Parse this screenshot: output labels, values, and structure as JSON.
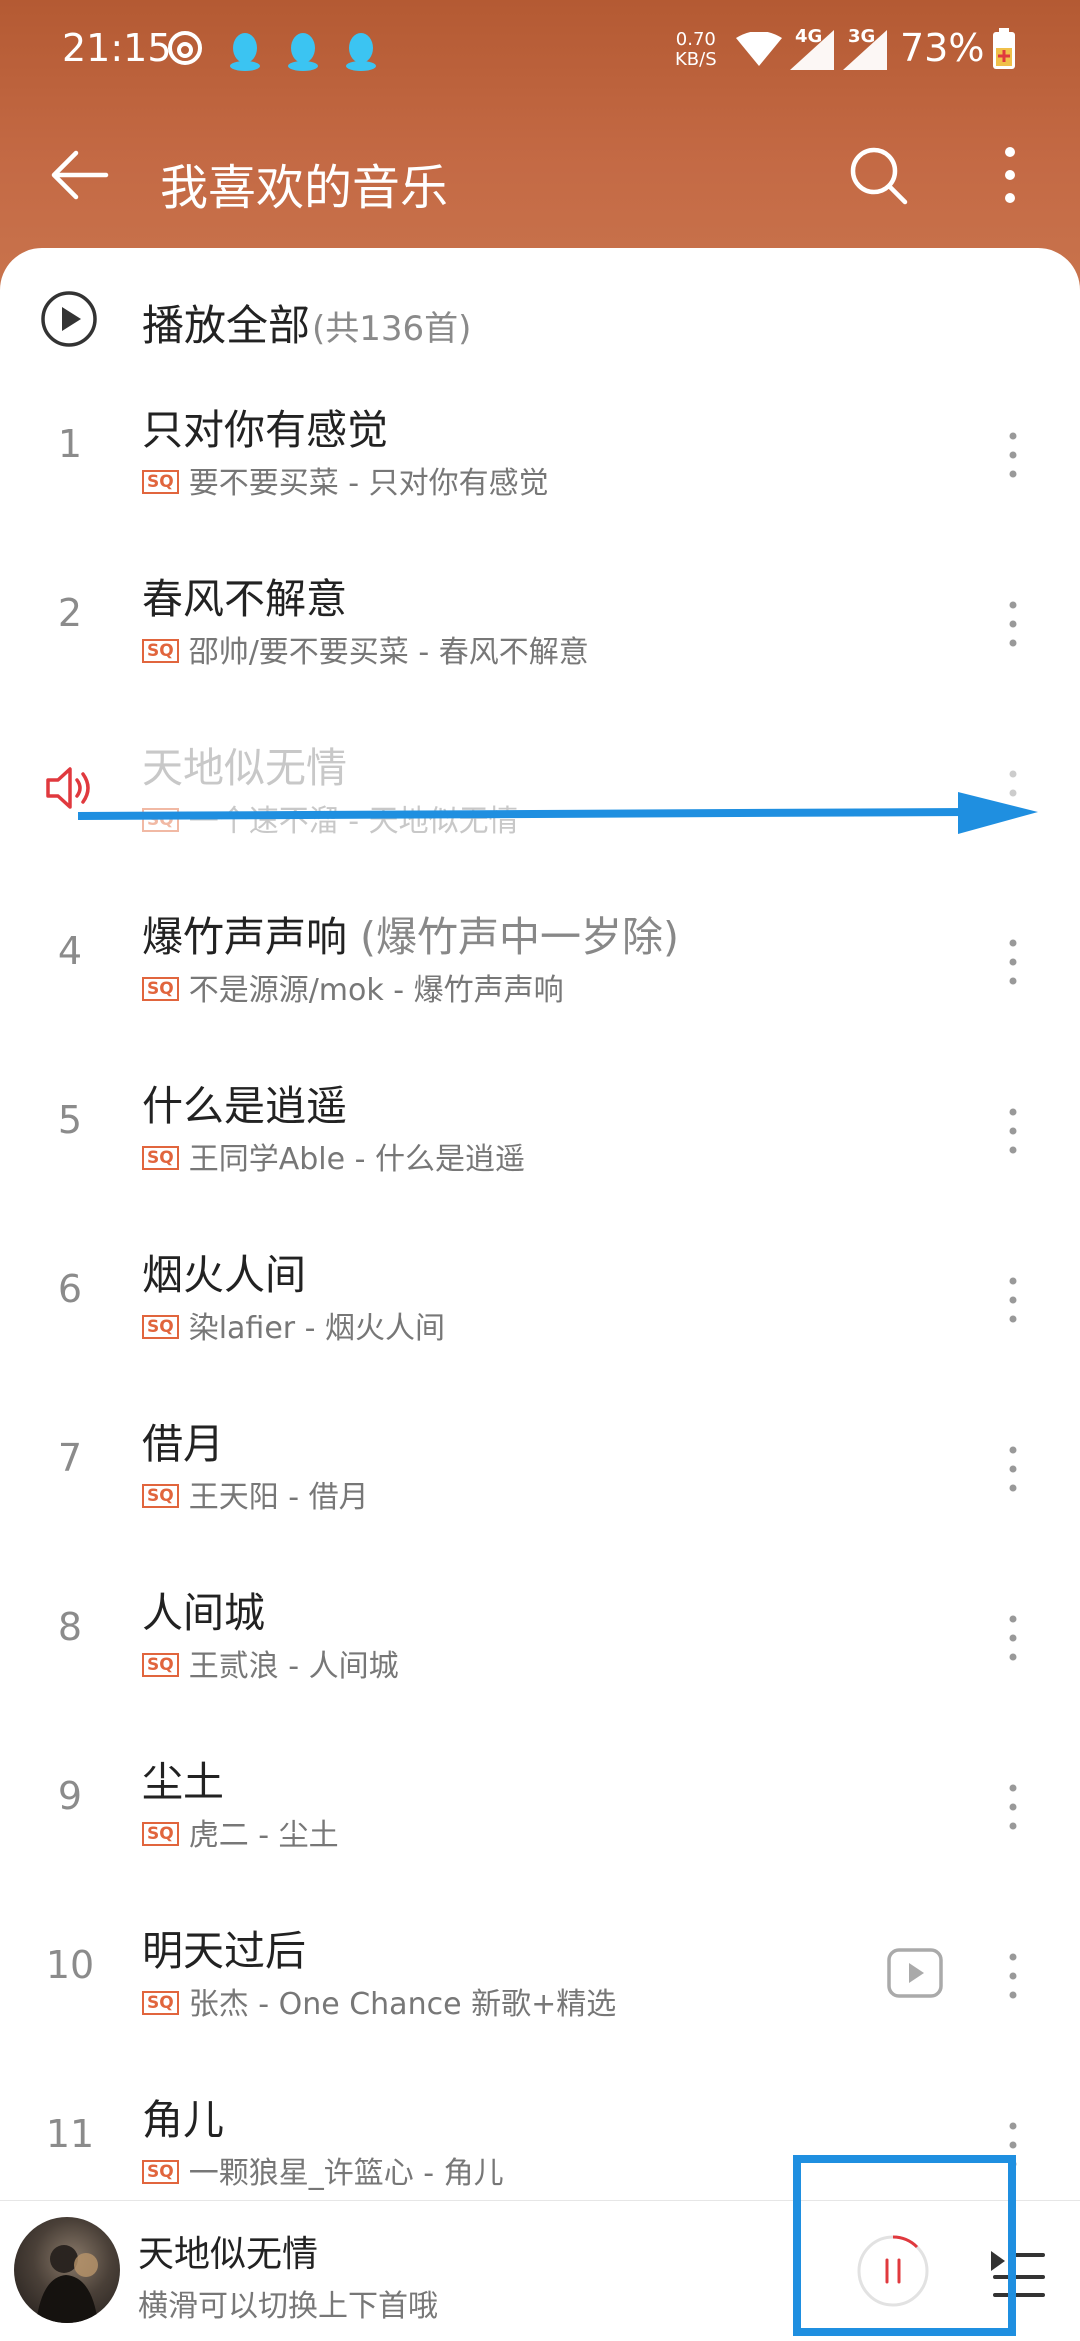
{
  "status_bar": {
    "time": "21:15",
    "net_speed_value": "0.70",
    "net_speed_unit": "KB/S",
    "signal1_label": "4G",
    "signal2_label": "3G",
    "battery": "73%"
  },
  "topbar": {
    "title": "我喜欢的音乐"
  },
  "play_all": {
    "label": "播放全部",
    "count": "(共136首)"
  },
  "songs": [
    {
      "index": "1",
      "title": "只对你有感觉",
      "title_alt": "",
      "subtitle": "要不要买菜 - 只对你有感觉"
    },
    {
      "index": "2",
      "title": "春风不解意",
      "title_alt": "",
      "subtitle": "邵帅/要不要买菜 - 春风不解意"
    },
    {
      "index": "",
      "title": "天地似无情",
      "title_alt": "",
      "subtitle": "一个速不溜 - 天地似无情"
    },
    {
      "index": "4",
      "title": "爆竹声声响",
      "title_alt": " (爆竹声中一岁除)",
      "subtitle": "不是源源/mok - 爆竹声声响"
    },
    {
      "index": "5",
      "title": "什么是逍遥",
      "title_alt": "",
      "subtitle": "王同学Able - 什么是逍遥"
    },
    {
      "index": "6",
      "title": "烟火人间",
      "title_alt": "",
      "subtitle": "染lafier - 烟火人间"
    },
    {
      "index": "7",
      "title": "借月",
      "title_alt": "",
      "subtitle": "王天阳 - 借月"
    },
    {
      "index": "8",
      "title": "人间城",
      "title_alt": "",
      "subtitle": "王贰浪 - 人间城"
    },
    {
      "index": "9",
      "title": "尘土",
      "title_alt": "",
      "subtitle": "虎二 - 尘土"
    },
    {
      "index": "10",
      "title": "明天过后",
      "title_alt": "",
      "subtitle": "张杰 - One Chance 新歌+精选"
    },
    {
      "index": "11",
      "title": "角儿",
      "title_alt": "",
      "subtitle": "一颗狼星_许篮心 - 角儿"
    }
  ],
  "badge_text": "SQ",
  "player": {
    "title": "天地似无情",
    "hint": "横滑可以切换上下首哦"
  },
  "colors": {
    "header": "#b45a33",
    "accent": "#e1653d",
    "playing_speaker": "#e0393e",
    "annotation": "#1f8fe0"
  },
  "icons": [
    "netease-music-icon",
    "qq-icon",
    "wifi-icon",
    "signal-icon",
    "battery-icon",
    "back-arrow-icon",
    "search-icon",
    "more-vertical-icon",
    "play-circle-icon",
    "speaker-icon",
    "mv-play-icon",
    "pause-icon",
    "playlist-icon"
  ]
}
